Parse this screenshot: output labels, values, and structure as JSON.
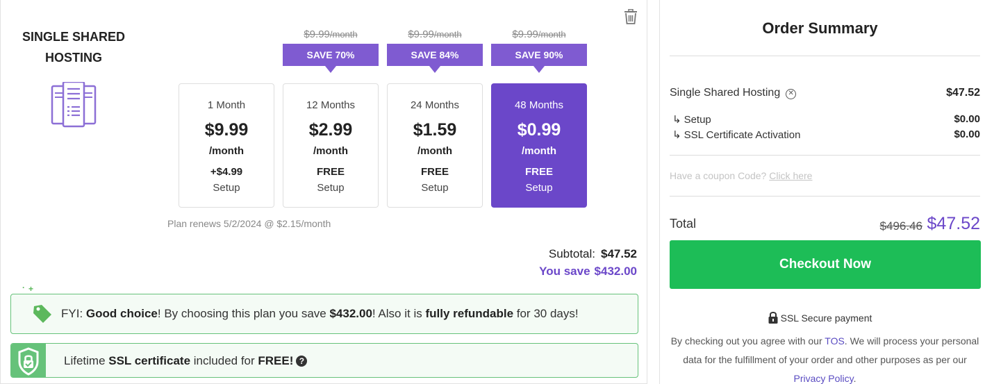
{
  "product": {
    "title": "SINGLE SHARED HOSTING",
    "icon": "server-icon"
  },
  "plans": [
    {
      "term": "1 Month",
      "price": "$9.99",
      "per": "/month",
      "setup_value": "+$4.99",
      "setup_label": "Setup",
      "original_price": "",
      "original_per": "",
      "save": ""
    },
    {
      "term": "12 Months",
      "price": "$2.99",
      "per": "/month",
      "setup_value": "FREE",
      "setup_label": "Setup",
      "original_price": "$9.99",
      "original_per": "/month",
      "save": "SAVE 70%"
    },
    {
      "term": "24 Months",
      "price": "$1.59",
      "per": "/month",
      "setup_value": "FREE",
      "setup_label": "Setup",
      "original_price": "$9.99",
      "original_per": "/month",
      "save": "SAVE 84%"
    },
    {
      "term": "48 Months",
      "price": "$0.99",
      "per": "/month",
      "setup_value": "FREE",
      "setup_label": "Setup",
      "original_price": "$9.99",
      "original_per": "/month",
      "save": "SAVE 90%",
      "selected": true
    }
  ],
  "renewal": "Plan renews 5/2/2024 @ $2.15/month",
  "subtotal": {
    "label": "Subtotal:",
    "value": "$47.52"
  },
  "you_save": {
    "label": "You save",
    "value": "$432.00"
  },
  "fyi": {
    "p1": "FYI: ",
    "b1": "Good choice",
    "p2": "! By choosing this plan you save ",
    "b2": "$432.00",
    "p3": "! Also it is ",
    "b3": "fully refundable",
    "p4": " for 30 days!"
  },
  "ssl": {
    "p1": "Lifetime ",
    "b1": "SSL certificate",
    "p2": " included for ",
    "b2": "FREE!",
    "help": "?"
  },
  "summary": {
    "title": "Order Summary",
    "item": {
      "label": "Single Shared Hosting",
      "value": "$47.52"
    },
    "sub_items": [
      {
        "arrow": "↳",
        "label": "Setup",
        "value": "$0.00"
      },
      {
        "arrow": "↳",
        "label": "SSL Certificate Activation",
        "value": "$0.00"
      }
    ],
    "coupon_text": "Have a coupon Code?",
    "coupon_link": "Click here",
    "total_label": "Total",
    "total_original": "$496.46",
    "total_value": "$47.52",
    "checkout_label": "Checkout Now",
    "secure_text": "SSL Secure payment",
    "terms_p1": "By checking out you agree with our ",
    "terms_tos": "TOS",
    "terms_p2": ". We will process your personal data for the fulfillment of your order and other purposes as per our ",
    "terms_privacy": "Privacy Policy",
    "terms_p3": "."
  },
  "colors": {
    "accent": "#6b47c9",
    "badge": "#7f5bd1",
    "checkout": "#1dbd57",
    "success_border": "#66c27a"
  }
}
